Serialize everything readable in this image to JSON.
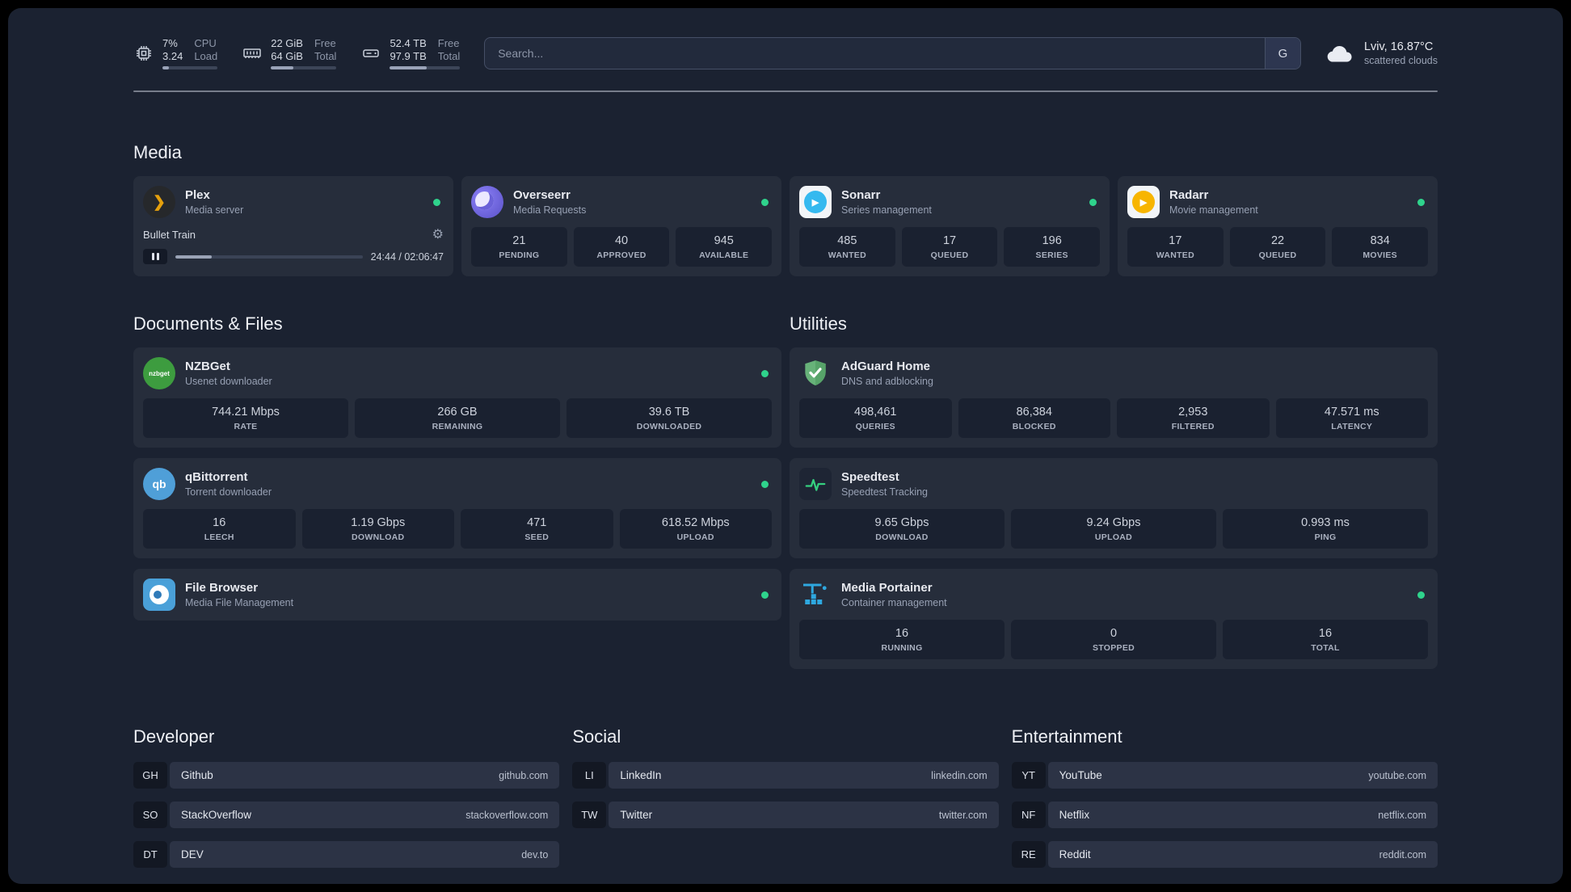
{
  "colors": {
    "background": "#1b2231",
    "card": "#262d3d",
    "stat_box": "#1a2130",
    "status_green": "#2fd38c",
    "plex_amber": "#e5a00d",
    "sonarr_blue": "#35b9ef",
    "radarr_amber": "#f7b500",
    "adguard_green": "#67b279",
    "speedtest_green": "#35d07f",
    "portainer_blue": "#2ea8e0"
  },
  "icons": {
    "plex_glyph": "❯",
    "gear_glyph": "⚙",
    "sonarr_glyph": "▶",
    "radarr_glyph": "▶",
    "nzbget_text": "nzbget",
    "qbittorrent_text": "qb"
  },
  "topbar": {
    "resources": [
      {
        "value1": "7%",
        "label1": "CPU",
        "value2": "3.24",
        "label2": "Load",
        "progress": 12
      },
      {
        "value1": "22 GiB",
        "label1": "Free",
        "value2": "64 GiB",
        "label2": "Total",
        "progress": 34
      },
      {
        "value1": "52.4 TB",
        "label1": "Free",
        "value2": "97.9 TB",
        "label2": "Total",
        "progress": 53
      }
    ],
    "search": {
      "placeholder": "Search...",
      "button_label": "G"
    },
    "weather": {
      "location": "Lviv, 16.87°C",
      "condition": "scattered clouds"
    }
  },
  "media": {
    "title": "Media",
    "plex": {
      "name": "Plex",
      "subtitle": "Media server",
      "now_playing": "Bullet Train",
      "time": "24:44 / 02:06:47",
      "progress_percent": 19.5
    },
    "overseerr": {
      "name": "Overseerr",
      "subtitle": "Media Requests",
      "stats": [
        {
          "value": "21",
          "label": "PENDING"
        },
        {
          "value": "40",
          "label": "APPROVED"
        },
        {
          "value": "945",
          "label": "AVAILABLE"
        }
      ]
    },
    "sonarr": {
      "name": "Sonarr",
      "subtitle": "Series management",
      "stats": [
        {
          "value": "485",
          "label": "WANTED"
        },
        {
          "value": "17",
          "label": "QUEUED"
        },
        {
          "value": "196",
          "label": "SERIES"
        }
      ]
    },
    "radarr": {
      "name": "Radarr",
      "subtitle": "Movie management",
      "stats": [
        {
          "value": "17",
          "label": "WANTED"
        },
        {
          "value": "22",
          "label": "QUEUED"
        },
        {
          "value": "834",
          "label": "MOVIES"
        }
      ]
    }
  },
  "documents": {
    "title": "Documents & Files",
    "nzbget": {
      "name": "NZBGet",
      "subtitle": "Usenet downloader",
      "stats": [
        {
          "value": "744.21 Mbps",
          "label": "RATE"
        },
        {
          "value": "266 GB",
          "label": "REMAINING"
        },
        {
          "value": "39.6 TB",
          "label": "DOWNLOADED"
        }
      ]
    },
    "qbittorrent": {
      "name": "qBittorrent",
      "subtitle": "Torrent downloader",
      "stats": [
        {
          "value": "16",
          "label": "LEECH"
        },
        {
          "value": "1.19 Gbps",
          "label": "DOWNLOAD"
        },
        {
          "value": "471",
          "label": "SEED"
        },
        {
          "value": "618.52 Mbps",
          "label": "UPLOAD"
        }
      ]
    },
    "filebrowser": {
      "name": "File Browser",
      "subtitle": "Media File Management"
    }
  },
  "utilities": {
    "title": "Utilities",
    "adguard": {
      "name": "AdGuard Home",
      "subtitle": "DNS and adblocking",
      "stats": [
        {
          "value": "498,461",
          "label": "QUERIES"
        },
        {
          "value": "86,384",
          "label": "BLOCKED"
        },
        {
          "value": "2,953",
          "label": "FILTERED"
        },
        {
          "value": "47.571 ms",
          "label": "LATENCY"
        }
      ]
    },
    "speedtest": {
      "name": "Speedtest",
      "subtitle": "Speedtest Tracking",
      "stats": [
        {
          "value": "9.65 Gbps",
          "label": "DOWNLOAD"
        },
        {
          "value": "9.24 Gbps",
          "label": "UPLOAD"
        },
        {
          "value": "0.993 ms",
          "label": "PING"
        }
      ]
    },
    "portainer": {
      "name": "Media Portainer",
      "subtitle": "Container management",
      "stats": [
        {
          "value": "16",
          "label": "RUNNING"
        },
        {
          "value": "0",
          "label": "STOPPED"
        },
        {
          "value": "16",
          "label": "TOTAL"
        }
      ]
    }
  },
  "bookmarks": {
    "developer": {
      "title": "Developer",
      "items": [
        {
          "abbr": "GH",
          "name": "Github",
          "url": "github.com"
        },
        {
          "abbr": "SO",
          "name": "StackOverflow",
          "url": "stackoverflow.com"
        },
        {
          "abbr": "DT",
          "name": "DEV",
          "url": "dev.to"
        }
      ]
    },
    "social": {
      "title": "Social",
      "items": [
        {
          "abbr": "LI",
          "name": "LinkedIn",
          "url": "linkedin.com"
        },
        {
          "abbr": "TW",
          "name": "Twitter",
          "url": "twitter.com"
        }
      ]
    },
    "entertainment": {
      "title": "Entertainment",
      "items": [
        {
          "abbr": "YT",
          "name": "YouTube",
          "url": "youtube.com"
        },
        {
          "abbr": "NF",
          "name": "Netflix",
          "url": "netflix.com"
        },
        {
          "abbr": "RE",
          "name": "Reddit",
          "url": "reddit.com"
        }
      ]
    }
  }
}
